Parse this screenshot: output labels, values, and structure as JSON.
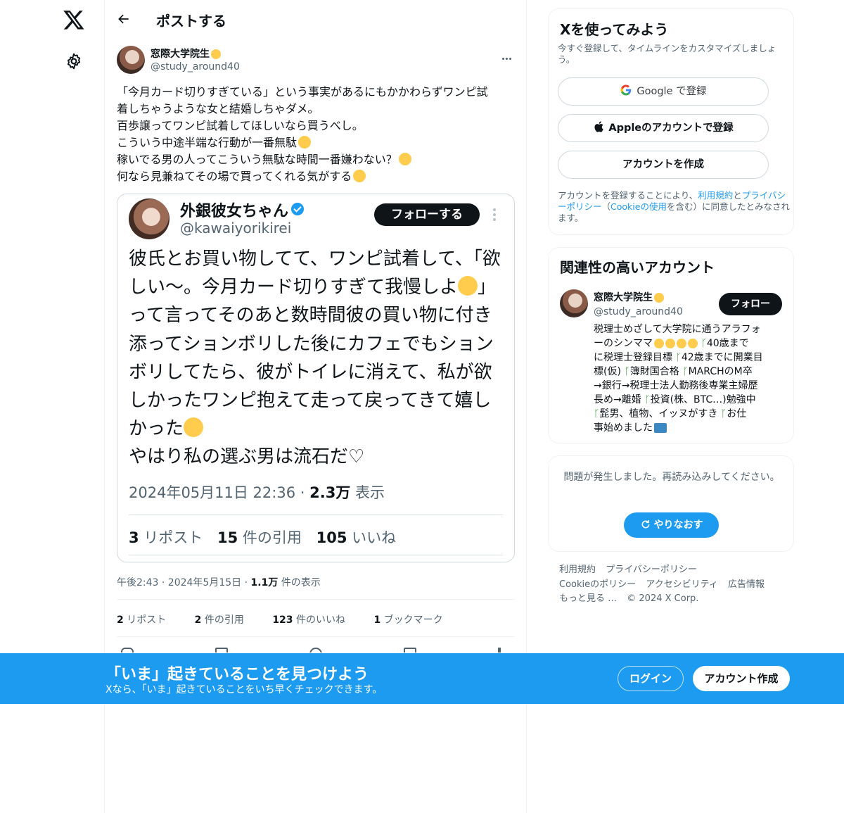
{
  "nav": {
    "logo_icon": "x-logo-icon",
    "settings_icon": "gear-icon"
  },
  "header": {
    "title": "ポストする",
    "back_icon": "arrow-left-icon"
  },
  "post": {
    "author_name": "窓際大学院生",
    "author_handle": "@study_around40",
    "text_lines": [
      "「今月カード切りすぎている」という事実があるにもかかわらずワンピ試",
      "着しちゃうような女と結婚しちゃダメ。",
      "百歩譲ってワンピ試着してほしいなら買うべし。",
      "こういう中途半端な行動が一番無駄",
      "稼いでる男の人ってこういう無駄な時間一番嫌わない？",
      "何なら見兼ねてその場で買ってくれる気がする"
    ],
    "timestamp": "午後2:43 · 2024年5月15日 · ",
    "views_count": "1.1万",
    "views_label": " 件の表示",
    "stats": {
      "reposts_count": "2",
      "reposts_label": " リポスト",
      "quotes_count": "2",
      "quotes_label": " 件の引用",
      "likes_count": "123",
      "likes_label": " 件のいいね",
      "bookmarks_count": "1",
      "bookmarks_label": " ブックマーク"
    }
  },
  "embedded_image": {
    "name": "外銀彼女ちゃん",
    "handle": "@kawaiyorikirei",
    "follow_label": "フォローする",
    "body_lines": [
      "彼氏とお買い物してて、ワンピ試着して、「欲",
      "しい〜。今月カード切りすぎて我慢しよ",
      "って言ってそのあと数時間彼の買い物に付き",
      "添ってションボリした後にカフェでもション",
      "ボリしてたら、彼がトイレに消えて、私が欲",
      "しかったワンピ抱えて走って戻ってきて嬉し",
      "かった",
      "やはり私の選ぶ男は流石だ♡"
    ],
    "meta_date": "2024年05月11日 22:36 · ",
    "meta_views": "2.3万",
    "meta_views_label": " 表示",
    "reposts_count": "3",
    "reposts_label": " リポスト",
    "quotes_count": "15",
    "quotes_label": " 件の引用",
    "likes_count": "105",
    "likes_label": " いいね"
  },
  "signup": {
    "title": "Xを使ってみよう",
    "subtitle": "今すぐ登録して、タイムラインをカスタマイズしましょう。",
    "google_label": "Google で登録",
    "apple_label": "Appleのアカウントで登録",
    "create_label": "アカウントを作成",
    "terms_prefix": "アカウントを登録することにより、",
    "terms_link": "利用規約",
    "terms_and": "と",
    "privacy_link": "プライバシーポリシー",
    "terms_paren_open": "（",
    "cookie_link": "Cookieの使用",
    "terms_suffix": "を含む）に同意したとみなされます。"
  },
  "related": {
    "title": "関連性の高いアカウント",
    "name": "窓際大学院生",
    "handle": "@study_around40",
    "follow_label": "フォロー",
    "bio_lines": [
      "税理士めざして大学院に通うアラフォ",
      "ーのシンママ",
      "に税理士登録目標 ",
      "標(仮) ",
      "→銀行→税理士法人勤務後専業主婦歴",
      "長め→離婚 ",
      "事始めました"
    ],
    "bio_extra": {
      "b1": "40歳まで",
      "b2": "42歳までに開業目",
      "b3": "簿財国合格 ",
      "b4": "MARCHのM卒",
      "b5": "投資(株、BTC…)勉強中",
      "b6": "髭男、植物、イッヌがすき ",
      "b7": "お仕"
    }
  },
  "error": {
    "text": "問題が発生しました。再読み込みしてください。",
    "retry_label": "やりなおす"
  },
  "footer": {
    "links": [
      "利用規約",
      "プライバシーポリシー",
      "Cookieのポリシー",
      "アクセシビリティ",
      "広告情報",
      "もっと見る …",
      "© 2024 X Corp."
    ]
  },
  "banner": {
    "title": "「いま」起きていることを見つけよう",
    "subtitle": "Xなら、「いま」起きていることをいち早くチェックできます。",
    "login_label": "ログイン",
    "signup_label": "アカウント作成"
  },
  "colors": {
    "accent": "#1d9bf0",
    "text": "#0f1419",
    "muted": "#536471",
    "dark_button": "#0f1419"
  }
}
